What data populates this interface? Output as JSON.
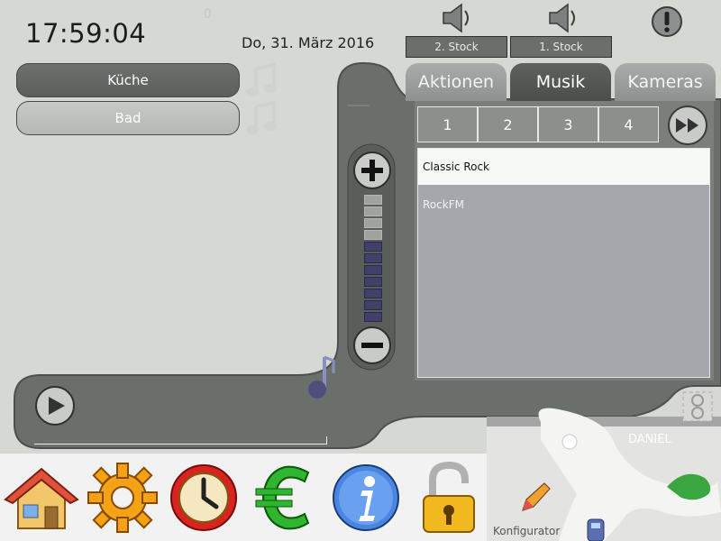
{
  "header": {
    "time": "17:59:04",
    "date": "Do, 31. März 2016",
    "indicator": "0"
  },
  "rooms": [
    {
      "label": "Küche",
      "selected": true
    },
    {
      "label": "Bad",
      "selected": false
    }
  ],
  "floors": [
    {
      "label": "2. Stock"
    },
    {
      "label": "1. Stock"
    }
  ],
  "tabs": [
    {
      "label": "Aktionen",
      "active": false
    },
    {
      "label": "Musik",
      "active": true
    },
    {
      "label": "Kameras",
      "active": false
    }
  ],
  "presets": [
    "1",
    "2",
    "3",
    "4"
  ],
  "stations": [
    {
      "label": "Classic Rock",
      "selected": true
    },
    {
      "label": "RockFM",
      "selected": false
    }
  ],
  "volume": {
    "level": 7,
    "max": 11
  },
  "user": {
    "name": "DANIEL"
  },
  "dock": {
    "items": [
      "home-icon",
      "gear-icon",
      "clock-icon",
      "euro-icon",
      "info-icon",
      "lock-icon"
    ],
    "configurator_label": "Konfigurator"
  },
  "colors": {
    "panel": "#686d6a",
    "panel_dark": "#4e5350",
    "background": "#d6d8d4",
    "accent_volume": "#404068"
  }
}
